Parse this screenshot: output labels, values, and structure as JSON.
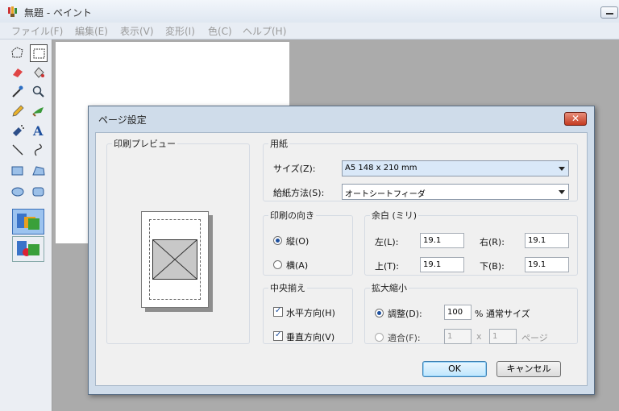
{
  "window": {
    "title": "無題 - ペイント"
  },
  "menu": [
    "ファイル(F)",
    "編集(E)",
    "表示(V)",
    "変形(I)",
    "色(C)",
    "ヘルプ(H)"
  ],
  "dialog": {
    "title": "ページ設定",
    "close_glyph": "✕",
    "preview_group": "印刷プレビュー",
    "paper": {
      "group": "用紙",
      "size_label": "サイズ(Z):",
      "size_value": "A5 148 x 210 mm",
      "source_label": "給紙方法(S):",
      "source_value": "オートシートフィーダ"
    },
    "orientation": {
      "group": "印刷の向き",
      "portrait": "縦(O)",
      "landscape": "横(A)",
      "selected": "portrait"
    },
    "margins": {
      "group": "余白 (ミリ)",
      "left_label": "左(L):",
      "left": "19.1",
      "right_label": "右(R):",
      "right": "19.1",
      "top_label": "上(T):",
      "top": "19.1",
      "bottom_label": "下(B):",
      "bottom": "19.1"
    },
    "centering": {
      "group": "中央揃え",
      "horizontal": "水平方向(H)",
      "vertical": "垂直方向(V)",
      "horizontal_checked": true,
      "vertical_checked": true
    },
    "scaling": {
      "group": "拡大縮小",
      "adjust_label": "調整(D):",
      "adjust_value": "100",
      "adjust_suffix": "% 通常サイズ",
      "fit_label": "適合(F):",
      "fit_w": "1",
      "times": "x",
      "fit_h": "1",
      "fit_suffix": "ページ",
      "selected": "adjust"
    },
    "ok": "OK",
    "cancel": "キャンセル"
  }
}
